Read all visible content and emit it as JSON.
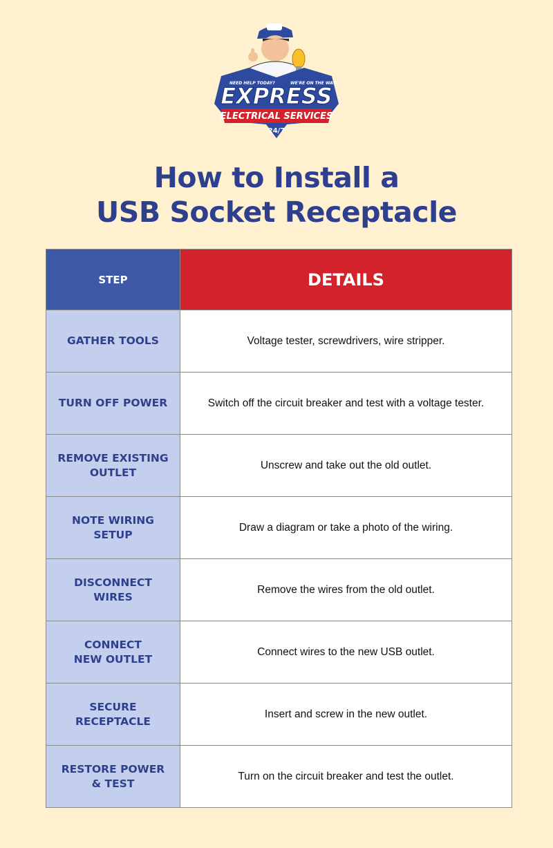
{
  "brand": {
    "name": "EXPRESS",
    "subtitle": "ELECTRICAL SERVICES",
    "availability": "24/7",
    "tagline_left": "NEED HELP TODAY?",
    "tagline_right": "WE'RE ON THE WAY!",
    "colors": {
      "blue": "#2e4a9e",
      "red": "#d3222b"
    }
  },
  "title": {
    "line1": "How to Install a",
    "line2": "USB Socket Receptacle"
  },
  "table": {
    "headers": {
      "step": "STEP",
      "details": "DETAILS"
    },
    "rows": [
      {
        "step": [
          "GATHER TOOLS"
        ],
        "details": "Voltage tester, screwdrivers, wire stripper."
      },
      {
        "step": [
          "TURN OFF POWER"
        ],
        "details": "Switch off the circuit breaker and test with a voltage tester."
      },
      {
        "step": [
          "REMOVE EXISTING",
          "OUTLET"
        ],
        "details": "Unscrew and take out the old outlet."
      },
      {
        "step": [
          "NOTE WIRING",
          "SETUP"
        ],
        "details": "Draw a diagram or take a photo of the wiring."
      },
      {
        "step": [
          "DISCONNECT",
          "WIRES"
        ],
        "details": "Remove the wires from the old outlet."
      },
      {
        "step": [
          "CONNECT",
          "NEW OUTLET"
        ],
        "details": "Connect wires to the new USB outlet."
      },
      {
        "step": [
          "SECURE",
          "RECEPTACLE"
        ],
        "details": "Insert and screw in the new outlet."
      },
      {
        "step": [
          "RESTORE POWER",
          "& TEST"
        ],
        "details": "Turn on the circuit breaker and test the outlet."
      }
    ]
  }
}
